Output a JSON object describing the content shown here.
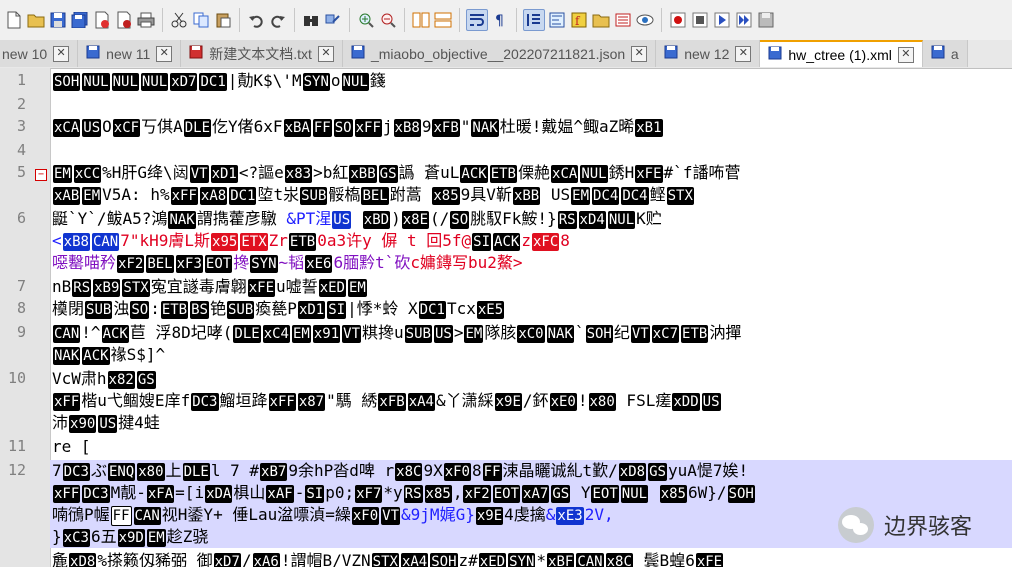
{
  "toolbar": {
    "icons": [
      "new-file-icon",
      "open-file-icon",
      "save-icon",
      "save-all-icon",
      "close-icon",
      "close-all-icon",
      "print-icon",
      "cut-icon",
      "copy-icon",
      "paste-icon",
      "undo-icon",
      "redo-icon",
      "find-icon",
      "replace-icon",
      "zoom-in-icon",
      "zoom-out-icon",
      "sync-v-icon",
      "sync-h-icon",
      "word-wrap-icon",
      "all-chars-icon",
      "indent-guide-icon",
      "doc-map-icon",
      "function-list-icon",
      "folder-workspace-icon",
      "monitor-icon",
      "record-macro-icon",
      "stop-macro-icon",
      "play-macro-icon",
      "run-macro-icon",
      "save-macro-icon"
    ]
  },
  "tabs": [
    {
      "label": "new 10"
    },
    {
      "label": "new 11"
    },
    {
      "label": "新建文本文档.txt"
    },
    {
      "label": "_miaobo_objective__202207211821.json"
    },
    {
      "label": "new 12"
    },
    {
      "label": "hw_ctree (1).xml"
    },
    {
      "label": "a"
    }
  ],
  "gutter": {
    "numbers": [
      "1",
      "2",
      "3",
      "4",
      "5",
      "6",
      "7",
      "8",
      "9",
      "10",
      "11",
      "12"
    ]
  },
  "lines": {
    "l1a": "SOH",
    "l1b": "NUL",
    "l1c": "NUL",
    "l1d": "NUL",
    "l1e": "xD7",
    "l1f": "DC1",
    "l1g": "|勣K$\\'M",
    "l1h": "SYN",
    "l1i": "o",
    "l1j": "NUL",
    "l1k": "籛",
    "l3a": "xCA",
    "l3b": "US",
    "l3c": "O",
    "l3d": "xCF",
    "l3e": "丂倛A",
    "l3f": "DLE",
    "l3g": "仡Y偖6xF",
    "l3h": "xBA",
    "l3i": "FF",
    "l3j": "SO",
    "l3k": "xFF",
    "l3l": "j",
    "l3m": "xB8",
    "l3n": "9",
    "l3o": "xFB",
    "l3p": "\"",
    "l3q": "NAK",
    "l3r": "杜暖!戴媪^鲰aZ晞",
    "l3s": "xB1",
    "l5a": "EM",
    "l5b": "xCC",
    "l5c": "%H肝G绛\\闼",
    "l5d": "VT",
    "l5e": "xD1",
    "l5f": "<?謳e",
    "l5g": "x83",
    "l5h": ">b紅",
    "l5i": "xBB",
    "l5j": "GS",
    "l5k": "譌 蒼uL",
    "l5l": "ACK",
    "l5m": "ETB",
    "l5n": "傈赩",
    "l5o": "xCA",
    "l5p": "NUL",
    "l5q": "銹H",
    "l5r": "xFE",
    "l5s": "#`f譒咘菅",
    "l5b1": "xAB",
    "l5b2": "EM",
    "l5b3": "V5A:  h%",
    "l5b4": "xFF",
    "l5b5": "xA8",
    "l5b6": "DC1",
    "l5b7": "埅t汖",
    "l5b8": "SUB",
    "l5b9": "骽槗",
    "l5b10": "BEL",
    "l5b11": "跗蒿  ",
    "l5b12": "x85",
    "l5b13": "9具V靳",
    "l5b14": "xBB",
    "l5b15": " US",
    "l5b16": "EM",
    "l5b17": "DC4",
    "l5b18": "DC4",
    "l5b19": "鲣",
    "l5b20": "STX",
    "l6a": "鼮`Y`/鲅A5?鴻",
    "l6b": "NAK",
    "l6c": "謂擕藿彦驐  ",
    "l6d": "&PT湦",
    "l6e": "US",
    "l6f": "  ",
    "l6g": "xBD",
    "l6h": ")",
    "l6i": "x8E",
    "l6j": "(/",
    "l6k": "SO",
    "l6l": "脁馭Fk鮟!}",
    "l6m": "RS",
    "l6n": "xD4",
    "l6o": "NUL",
    "l6p": "K贮",
    "l6b1": "<",
    "l6b2": "xB8",
    "l6b3": "CAN",
    "l6b4": "7\"kH9膚L斯",
    "l6b5": "x95",
    "l6b6": "ETX",
    "l6b7": "Zr",
    "l6b8": "ETB",
    "l6b9": "0a3许y  偋 t 回5f@",
    "l6b10": "SI",
    "l6b11": "ACK",
    "l6b12": "z",
    "l6b13": "xFC",
    "l6b14": "8",
    "l6c1": "噁罊喵矜",
    "l6c2": "xF2",
    "l6c3": "BEL",
    "l6c4": "xF3",
    "l6c5": "EOT",
    "l6c6": "搀",
    "l6c7": "SYN",
    "l6c8": "~韬",
    "l6c9": "xE6",
    "l6c10": "6腼黔t`砍",
    "l6c11": "c嫞鏄写bu2鰲>",
    "l7a": "nB",
    "l7b": "RS",
    "l7c": "xB9",
    "l7d": "STX",
    "l7e": "寃宜譢毒膚",
    "l7f": "翺",
    "l7g": "xFE",
    "l7h": "u嘘誓",
    "l7i": "xED",
    "l7j": "EM",
    "l8a": "橂閉",
    "l8b": "SUB",
    "l8c": "浊",
    "l8d": "SO",
    "l8e": ":",
    "l8f": "ETB",
    "l8g": "BS",
    "l8h": "铯",
    "l8i": "SUB",
    "l8j": "瘓甆P",
    "l8k": "xD1",
    "l8l": "SI",
    "l8m": "|悸*蛉  X",
    "l8n": "DC1",
    "l8o": "Tcx",
    "l8p": "xE5",
    "l9a": "CAN",
    "l9b": "!^",
    "l9c": "ACK",
    "l9d": "苣  浮8D圮哮(",
    "l9e": "DLE",
    "l9f": "xC4",
    "l9g": "EM",
    "l9h": "x91",
    "l9i": "VT",
    "l9j": "粸搀u",
    "l9k": "SUB",
    "l9l": "US",
    "l9m": ">",
    "l9n": "EM",
    "l9o": "隊胲",
    "l9p": "xC0",
    "l9q": "NAK",
    "l9r": "`",
    "l9s": "SOH",
    "l9t": "纪",
    "l9u": "VT",
    "l9v": "xC7",
    "l9w": "ETB",
    "l9x": "汭撣",
    "l9b1": "NAK",
    "l9b2": "ACK",
    "l9b3": "禒S$]^",
    "l10a": "VcW肃h",
    "l10b": "x82",
    "l10c": "GS",
    "l10b1": "xFF",
    "l10b2": "楷u弋鲴嫂E庠f",
    "l10b3": "DC3",
    "l10b4": "鰡垣跭",
    "l10b5": "xFF",
    "l10b6": "x87",
    "l10b7": "\"騳  綉",
    "l10b8": "xFB",
    "l10b9": "xA4",
    "l10b10": "&丫潇綵",
    "l10b11": "x9E",
    "l10b12": "/鈈",
    "l10b13": "xE0",
    "l10b14": "!",
    "l10b15": "x80",
    "l10b16": "  FS",
    "l10b17": "L瘥",
    "l10b18": "xDD",
    "l10b19": "US",
    "l10c1": "沛",
    "l10c2": "x90",
    "l10c3": "US",
    "l10c4": "揵4蛙",
    "l11a": "re  [",
    "l12a": "7",
    "l12b": "DC3",
    "l12c": "ぶ",
    "l12d": "ENQ",
    "l12e": "x80",
    "l12f": "上",
    "l12g": "DLE",
    "l12h": "l 7 #",
    "l12i": "xB7",
    "l12j": "9余hP沓d啤  r",
    "l12k": "x8C",
    "l12l": "9X",
    "l12m": "xF0",
    "l12n": "8",
    "l12o": "FF",
    "l12p": "涑晶矖诚糺t歏/",
    "l12q": "xD8",
    "l12r": "GS",
    "l12s": "yuA惿7娭!",
    "l12b1": "xFF",
    "l12b2": "DC3",
    "l12b3": "M靓-",
    "l12b4": "xFA",
    "l12b5": "=[i",
    "l12b6": "xDA",
    "l12b7": "椇山",
    "l12b8": "xAF",
    "l12b9": "-",
    "l12b10": "SI",
    "l12b11": "p0;",
    "l12b12": "xF7",
    "l12b13": "*y",
    "l12b14": "RS",
    "l12b15": "x85",
    "l12b16": ",",
    "l12b17": "xF2",
    "l12b18": "EOT",
    "l12b19": "xA7",
    "l12b20": "GS",
    "l12b21": "  Y",
    "l12b22": "EOT",
    "l12b23": "NUL",
    "l12b24": "  ",
    "l12b25": "x85",
    "l12b26": "6W}/",
    "l12b27": "SOH",
    "l12c1": "喃鴴P幄",
    "l12c2": "FF",
    "l12c3": "CAN",
    "l12c4": "视H鋈Y+  倕Lau湓嘌湞=繰",
    "l12c5": "xF0",
    "l12c6": "VT",
    "l12c7": "&9jM娓G}",
    "l12c8": "x9E",
    "l12c9": "4虔擒",
    "l12c10": "&",
    "l12c11": "xE3",
    "l12c12": "2V,",
    "l12d1": "}",
    "l12d2": "xC3",
    "l12d3": "6五",
    "l12d4": "x9D",
    "l12d5": "EM",
    "l12d6": "趁Z骁",
    "l12e1": "麁",
    "l12e2": "xD8",
    "l12e3": "%搽籁仭豨弼  御",
    "l12e4": "xD7",
    "l12e5": "/",
    "l12e6": "xA6",
    "l12e7": "!謂帽",
    "l12e8": "B/VZN",
    "l12e9": "STX",
    "l12e10": "xA4",
    "l12e11": "SOH",
    "l12e12": "z#",
    "l12e13": "xED",
    "l12e14": "SYN",
    "l12e15": "*",
    "l12e16": "xBF",
    "l12e17": "CAN",
    "l12e18": "x8C",
    "l12e19": "  鬓B蝗6",
    "l12e20": "xFE"
  },
  "watermark": {
    "text": "边界骇客"
  }
}
